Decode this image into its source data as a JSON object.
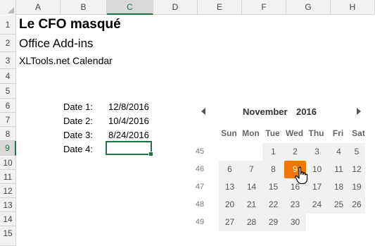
{
  "columns": [
    "A",
    "B",
    "C",
    "D",
    "E",
    "F",
    "G",
    "H"
  ],
  "rows": [
    "1",
    "2",
    "3",
    "4",
    "5",
    "6",
    "7",
    "8",
    "9",
    "10",
    "11",
    "12",
    "13",
    "14",
    "15"
  ],
  "sheet": {
    "title": "Le CFO masqué",
    "subtitle": "Office Add-ins",
    "line3": "XLTools.net Calendar",
    "date_labels": [
      "Date 1:",
      "Date 2:",
      "Date 3:",
      "Date 4:"
    ],
    "date_values": [
      "12/8/2016",
      "10/4/2016",
      "8/24/2016",
      ""
    ]
  },
  "calendar": {
    "month": "November",
    "year": "2016",
    "weekdays": [
      "Sun",
      "Mon",
      "Tue",
      "Wed",
      "Thu",
      "Fri",
      "Sat"
    ],
    "weeks": [
      {
        "num": "45",
        "days": [
          "",
          "",
          "1",
          "2",
          "3",
          "4",
          "5"
        ]
      },
      {
        "num": "46",
        "days": [
          "6",
          "7",
          "8",
          "9",
          "10",
          "11",
          "12"
        ]
      },
      {
        "num": "47",
        "days": [
          "13",
          "14",
          "15",
          "16",
          "17",
          "18",
          "19"
        ]
      },
      {
        "num": "48",
        "days": [
          "20",
          "21",
          "22",
          "23",
          "24",
          "25",
          "26"
        ]
      },
      {
        "num": "49",
        "days": [
          "27",
          "28",
          "29",
          "30",
          "",
          "",
          ""
        ]
      }
    ],
    "highlighted_day": "9",
    "accent_color": "#f07800"
  },
  "colors": {
    "excel_green": "#217346"
  }
}
